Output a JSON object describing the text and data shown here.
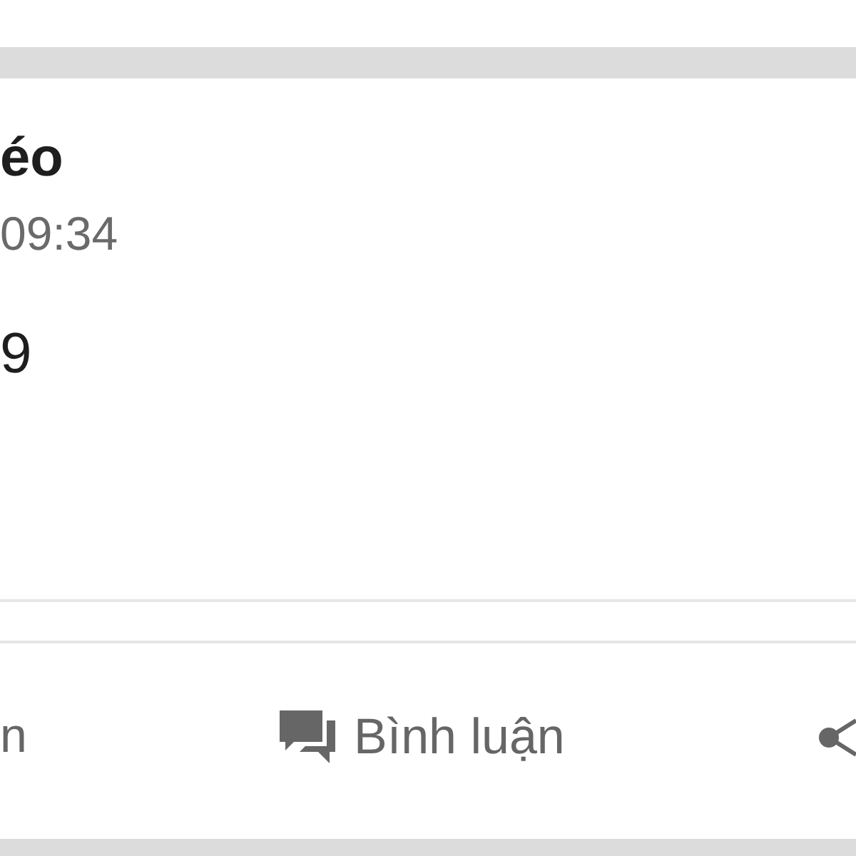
{
  "post": {
    "author": "éo",
    "time": "09:34",
    "body": "9"
  },
  "actions": [
    {
      "kind": "like",
      "label": "n"
    },
    {
      "kind": "comment",
      "label": "Bình luận"
    },
    {
      "kind": "share"
    }
  ]
}
